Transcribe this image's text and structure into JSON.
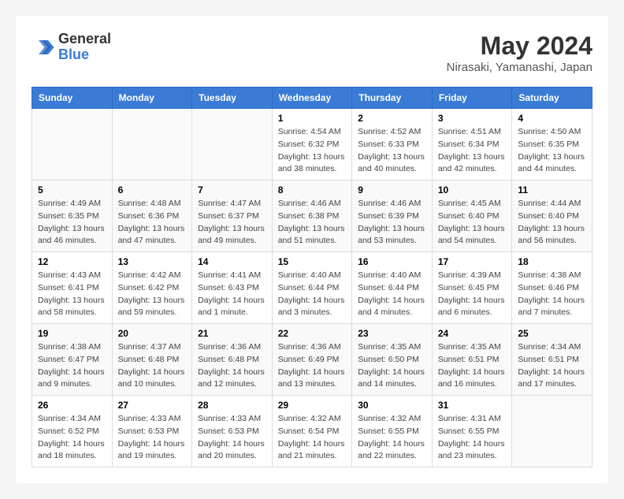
{
  "logo": {
    "general": "General",
    "blue": "Blue"
  },
  "title": "May 2024",
  "location": "Nirasaki, Yamanashi, Japan",
  "weekdays": [
    "Sunday",
    "Monday",
    "Tuesday",
    "Wednesday",
    "Thursday",
    "Friday",
    "Saturday"
  ],
  "weeks": [
    [
      {
        "day": "",
        "info": ""
      },
      {
        "day": "",
        "info": ""
      },
      {
        "day": "",
        "info": ""
      },
      {
        "day": "1",
        "info": "Sunrise: 4:54 AM\nSunset: 6:32 PM\nDaylight: 13 hours\nand 38 minutes."
      },
      {
        "day": "2",
        "info": "Sunrise: 4:52 AM\nSunset: 6:33 PM\nDaylight: 13 hours\nand 40 minutes."
      },
      {
        "day": "3",
        "info": "Sunrise: 4:51 AM\nSunset: 6:34 PM\nDaylight: 13 hours\nand 42 minutes."
      },
      {
        "day": "4",
        "info": "Sunrise: 4:50 AM\nSunset: 6:35 PM\nDaylight: 13 hours\nand 44 minutes."
      }
    ],
    [
      {
        "day": "5",
        "info": "Sunrise: 4:49 AM\nSunset: 6:35 PM\nDaylight: 13 hours\nand 46 minutes."
      },
      {
        "day": "6",
        "info": "Sunrise: 4:48 AM\nSunset: 6:36 PM\nDaylight: 13 hours\nand 47 minutes."
      },
      {
        "day": "7",
        "info": "Sunrise: 4:47 AM\nSunset: 6:37 PM\nDaylight: 13 hours\nand 49 minutes."
      },
      {
        "day": "8",
        "info": "Sunrise: 4:46 AM\nSunset: 6:38 PM\nDaylight: 13 hours\nand 51 minutes."
      },
      {
        "day": "9",
        "info": "Sunrise: 4:46 AM\nSunset: 6:39 PM\nDaylight: 13 hours\nand 53 minutes."
      },
      {
        "day": "10",
        "info": "Sunrise: 4:45 AM\nSunset: 6:40 PM\nDaylight: 13 hours\nand 54 minutes."
      },
      {
        "day": "11",
        "info": "Sunrise: 4:44 AM\nSunset: 6:40 PM\nDaylight: 13 hours\nand 56 minutes."
      }
    ],
    [
      {
        "day": "12",
        "info": "Sunrise: 4:43 AM\nSunset: 6:41 PM\nDaylight: 13 hours\nand 58 minutes."
      },
      {
        "day": "13",
        "info": "Sunrise: 4:42 AM\nSunset: 6:42 PM\nDaylight: 13 hours\nand 59 minutes."
      },
      {
        "day": "14",
        "info": "Sunrise: 4:41 AM\nSunset: 6:43 PM\nDaylight: 14 hours\nand 1 minute."
      },
      {
        "day": "15",
        "info": "Sunrise: 4:40 AM\nSunset: 6:44 PM\nDaylight: 14 hours\nand 3 minutes."
      },
      {
        "day": "16",
        "info": "Sunrise: 4:40 AM\nSunset: 6:44 PM\nDaylight: 14 hours\nand 4 minutes."
      },
      {
        "day": "17",
        "info": "Sunrise: 4:39 AM\nSunset: 6:45 PM\nDaylight: 14 hours\nand 6 minutes."
      },
      {
        "day": "18",
        "info": "Sunrise: 4:38 AM\nSunset: 6:46 PM\nDaylight: 14 hours\nand 7 minutes."
      }
    ],
    [
      {
        "day": "19",
        "info": "Sunrise: 4:38 AM\nSunset: 6:47 PM\nDaylight: 14 hours\nand 9 minutes."
      },
      {
        "day": "20",
        "info": "Sunrise: 4:37 AM\nSunset: 6:48 PM\nDaylight: 14 hours\nand 10 minutes."
      },
      {
        "day": "21",
        "info": "Sunrise: 4:36 AM\nSunset: 6:48 PM\nDaylight: 14 hours\nand 12 minutes."
      },
      {
        "day": "22",
        "info": "Sunrise: 4:36 AM\nSunset: 6:49 PM\nDaylight: 14 hours\nand 13 minutes."
      },
      {
        "day": "23",
        "info": "Sunrise: 4:35 AM\nSunset: 6:50 PM\nDaylight: 14 hours\nand 14 minutes."
      },
      {
        "day": "24",
        "info": "Sunrise: 4:35 AM\nSunset: 6:51 PM\nDaylight: 14 hours\nand 16 minutes."
      },
      {
        "day": "25",
        "info": "Sunrise: 4:34 AM\nSunset: 6:51 PM\nDaylight: 14 hours\nand 17 minutes."
      }
    ],
    [
      {
        "day": "26",
        "info": "Sunrise: 4:34 AM\nSunset: 6:52 PM\nDaylight: 14 hours\nand 18 minutes."
      },
      {
        "day": "27",
        "info": "Sunrise: 4:33 AM\nSunset: 6:53 PM\nDaylight: 14 hours\nand 19 minutes."
      },
      {
        "day": "28",
        "info": "Sunrise: 4:33 AM\nSunset: 6:53 PM\nDaylight: 14 hours\nand 20 minutes."
      },
      {
        "day": "29",
        "info": "Sunrise: 4:32 AM\nSunset: 6:54 PM\nDaylight: 14 hours\nand 21 minutes."
      },
      {
        "day": "30",
        "info": "Sunrise: 4:32 AM\nSunset: 6:55 PM\nDaylight: 14 hours\nand 22 minutes."
      },
      {
        "day": "31",
        "info": "Sunrise: 4:31 AM\nSunset: 6:55 PM\nDaylight: 14 hours\nand 23 minutes."
      },
      {
        "day": "",
        "info": ""
      }
    ]
  ]
}
